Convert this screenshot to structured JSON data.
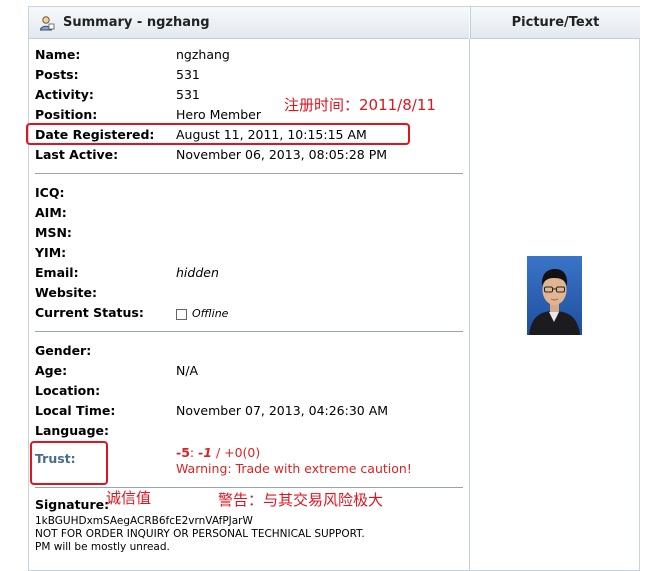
{
  "header": {
    "summary_title": "Summary - ngzhang",
    "picture_title": "Picture/Text"
  },
  "profile": {
    "name_label": "Name:",
    "name": "ngzhang",
    "posts_label": "Posts:",
    "posts": "531",
    "activity_label": "Activity:",
    "activity": "531",
    "position_label": "Position:",
    "position": "Hero Member",
    "registered_label": "Date Registered:",
    "registered": "August 11, 2011, 10:15:15 AM",
    "last_active_label": "Last Active:",
    "last_active": "November 06, 2013, 08:05:28 PM"
  },
  "contact": {
    "icq_label": "ICQ:",
    "aim_label": "AIM:",
    "msn_label": "MSN:",
    "yim_label": "YIM:",
    "email_label": "Email:",
    "email": "hidden",
    "website_label": "Website:",
    "status_label": "Current Status:",
    "status": "Offline"
  },
  "personal": {
    "gender_label": "Gender:",
    "age_label": "Age:",
    "age": "N/A",
    "location_label": "Location:",
    "local_time_label": "Local Time:",
    "local_time": "November 07, 2013, 04:26:30 AM",
    "language_label": "Language:",
    "trust_label": "Trust:",
    "trust_score_a": "-5",
    "trust_sep1": ": ",
    "trust_score_b": "-1",
    "trust_rest": " / +0(0)",
    "trust_warning": "Warning: Trade with extreme caution!"
  },
  "signature": {
    "label": "Signature:",
    "line1": "1kBGUHDxmSAegACRB6fcE2vrnVAfPJarW",
    "line2": "NOT FOR ORDER INQUIRY OR PERSONAL TECHNICAL SUPPORT.",
    "line3": "PM will be mostly unread."
  },
  "annotations": {
    "registered_note": "注册时间：2011/8/11",
    "trust_note": "诚信值",
    "warning_note": "警告：与其交易风险极大"
  },
  "colors": {
    "annotation_red": "#e0141e",
    "trust_label_blue": "#4a6b8a",
    "warning_red": "#d22222"
  }
}
